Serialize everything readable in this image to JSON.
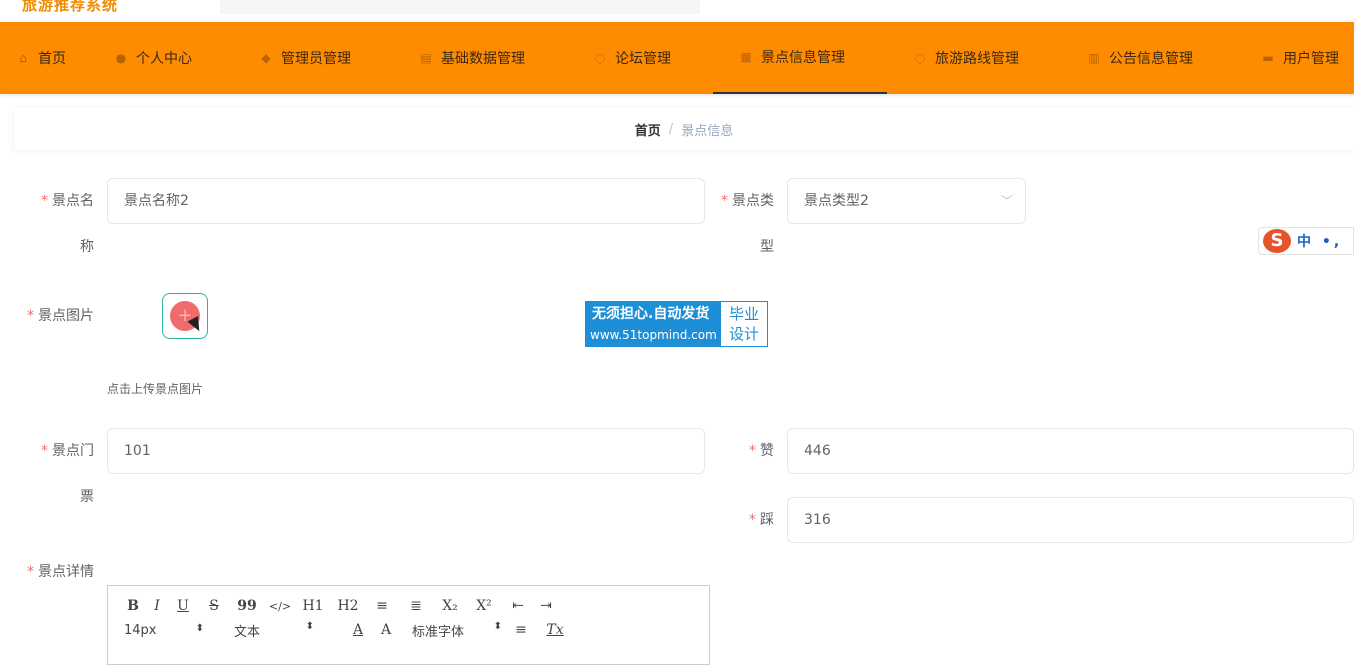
{
  "topbar": {
    "brand": "旅游推荐系统"
  },
  "nav": {
    "items": [
      {
        "label": "首页",
        "icon": "home-icon",
        "glyph": "⌂"
      },
      {
        "label": "个人中心",
        "icon": "user-icon",
        "glyph": "●"
      },
      {
        "label": "管理员管理",
        "icon": "admin-icon",
        "glyph": "◆"
      },
      {
        "label": "基础数据管理",
        "icon": "data-icon",
        "glyph": "▤"
      },
      {
        "label": "论坛管理",
        "icon": "forum-icon",
        "glyph": "◌"
      },
      {
        "label": "景点信息管理",
        "icon": "grid-icon",
        "glyph": "▦"
      },
      {
        "label": "旅游路线管理",
        "icon": "route-icon",
        "glyph": "◌"
      },
      {
        "label": "公告信息管理",
        "icon": "notice-icon",
        "glyph": "▥"
      },
      {
        "label": "用户管理",
        "icon": "users-icon",
        "glyph": "▬"
      }
    ]
  },
  "breadcrumb": {
    "home": "首页",
    "sep": "/",
    "current": "景点信息"
  },
  "form": {
    "name_label_1": "景点名",
    "name_label_2": "称",
    "name_value": "景点名称2",
    "type_label_1": "景点类",
    "type_label_2": "型",
    "type_value": "景点类型2",
    "image_label": "景点图片",
    "upload_plus": "+",
    "upload_tip": "点击上传景点图片",
    "ticket_label_1": "景点门",
    "ticket_label_2": "票",
    "ticket_value": "101",
    "like_label": "赞",
    "like_value": "446",
    "dislike_label": "踩",
    "dislike_value": "316",
    "detail_label": "景点详情",
    "required_mark": "*"
  },
  "watermark": {
    "line1": "无须担心.自动发货",
    "line2": "www.51topmind.com",
    "right1": "毕业",
    "right2": "设计"
  },
  "ime": {
    "logo": "S",
    "text": "中 •, "
  },
  "editor": {
    "row1": [
      "B",
      "I",
      "U",
      "S",
      "99",
      "</>",
      "H1",
      "H2",
      "≡",
      "≣",
      "X₂",
      "X²",
      "⇤",
      "⇥"
    ],
    "row2": {
      "size": "14px",
      "format": "文本",
      "font": "标准字体",
      "align": "≡",
      "clear": "Tx",
      "color": "A",
      "bg": "A"
    }
  }
}
